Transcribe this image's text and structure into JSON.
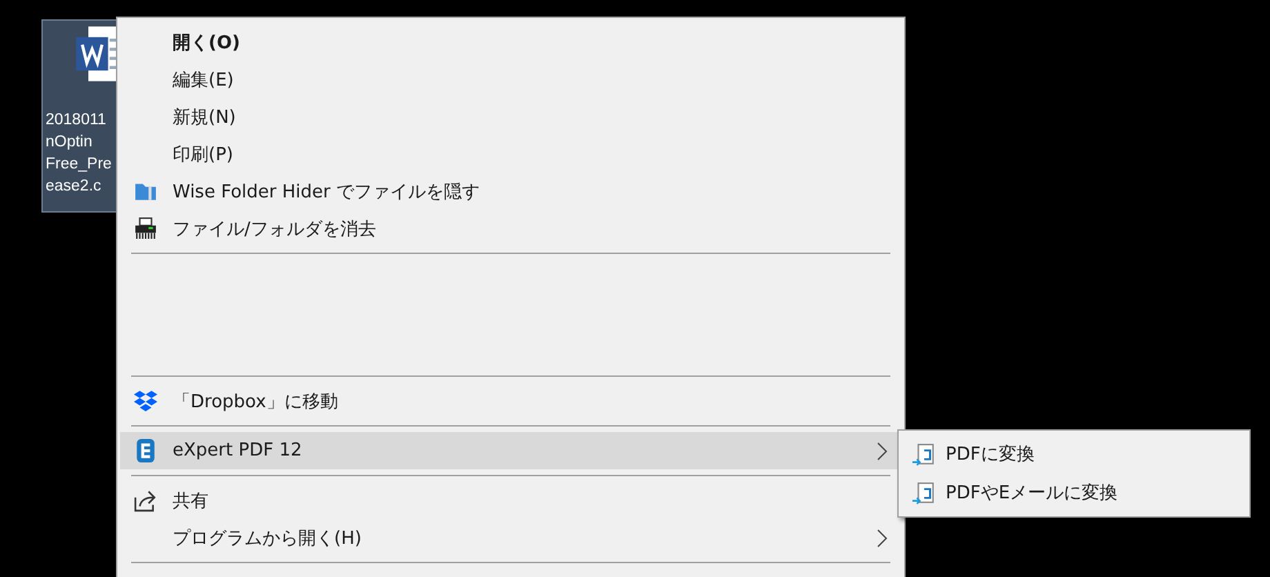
{
  "desktop_icon": {
    "selected": true,
    "label_lines": [
      "2018011",
      "nOptin",
      "Free_Pre",
      "ease2.c"
    ]
  },
  "context_menu": {
    "items": [
      {
        "kind": "item",
        "label": "開く(O)",
        "default": true,
        "selected": false,
        "submenu": false
      },
      {
        "kind": "item",
        "label": "編集(E)",
        "default": false,
        "selected": false,
        "submenu": false
      },
      {
        "kind": "item",
        "label": "新規(N)",
        "default": false,
        "selected": false,
        "submenu": false
      },
      {
        "kind": "item",
        "label": "印刷(P)",
        "default": false,
        "selected": false,
        "submenu": false
      },
      {
        "kind": "item",
        "label": "Wise Folder Hider でファイルを隠す",
        "default": false,
        "selected": false,
        "submenu": false
      },
      {
        "kind": "item",
        "label": "ファイル/フォルダを消去",
        "default": false,
        "selected": false,
        "submenu": false
      },
      {
        "kind": "separator"
      },
      {
        "kind": "blank"
      },
      {
        "kind": "separator"
      },
      {
        "kind": "item",
        "label": "「Dropbox」に移動",
        "default": false,
        "selected": false,
        "submenu": false
      },
      {
        "kind": "separator"
      },
      {
        "kind": "item",
        "label": "eXpert PDF 12",
        "default": false,
        "selected": true,
        "submenu": true
      },
      {
        "kind": "separator"
      },
      {
        "kind": "item",
        "label": "共有",
        "default": false,
        "selected": false,
        "submenu": false
      },
      {
        "kind": "item",
        "label": "プログラムから開く(H)",
        "default": false,
        "selected": false,
        "submenu": true
      },
      {
        "kind": "separator"
      }
    ]
  },
  "submenu": {
    "items": [
      {
        "label": "PDFに変換",
        "selected": false
      },
      {
        "label": "PDFやEメールに変換",
        "selected": false
      }
    ]
  }
}
